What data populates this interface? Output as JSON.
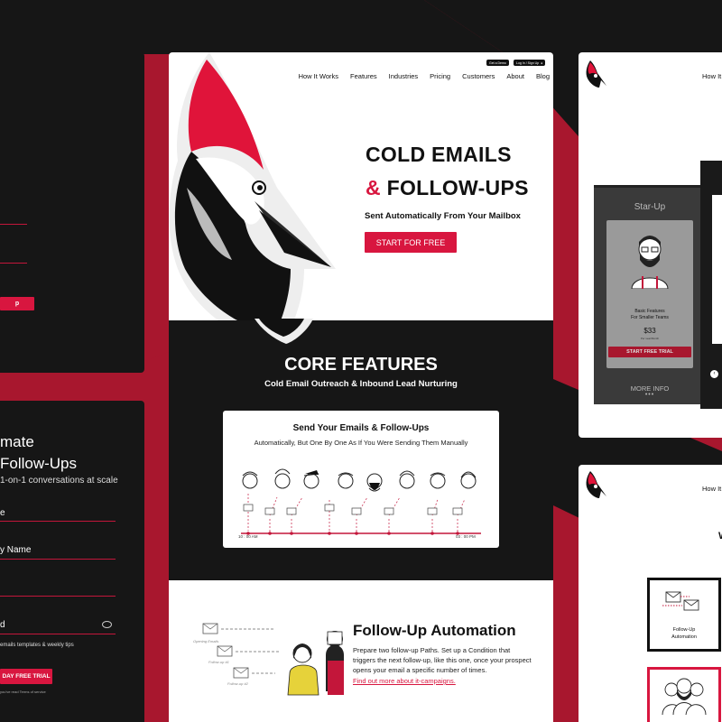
{
  "colors": {
    "accent": "#d8163f",
    "dark": "#161616",
    "background_red": "#a8172e"
  },
  "left_top": {
    "button_label": "p"
  },
  "left_bottom": {
    "headline_1": "mate",
    "headline_2": "Follow-Ups",
    "subline": "1-on-1 conversations at scale",
    "field_1": "e",
    "field_2": "y Name",
    "field_3": "d",
    "checkbox_label": "emails templates & weekly tips",
    "cta": "DAY FREE TRIAL",
    "fineprint": "you've read Terms of service"
  },
  "center": {
    "top_buttons": [
      "Get a Demo",
      "Log In / Sign Up"
    ],
    "nav": [
      "How It Works",
      "Features",
      "Industries",
      "Pricing",
      "Customers",
      "About",
      "Blog"
    ],
    "hero": {
      "title_line1": "COLD EMAILS",
      "title_amp": "&",
      "title_line2": "FOLLOW-UPS",
      "subtitle": "Sent Automatically From Your Mailbox",
      "cta": "START FOR FREE"
    },
    "core": {
      "title": "CORE FEATURES",
      "subtitle": "Cold Email Outreach & Inbound Lead Nurturing"
    },
    "card": {
      "title": "Send Your Emails & Follow-Ups",
      "subtitle": "Automatically, But One By One As If You Were Sending Them Manually",
      "time_start": "10 : 00 AM",
      "time_end": "03 : 00 PM"
    },
    "followup": {
      "title": "Follow-Up Automation",
      "body": "Prepare two follow-up Paths. Set up a Condition that triggers the next follow-up, like this one, once your prospect opens your email a specific number of times.",
      "link": "Find out more about it-campaigns.",
      "diagram_labels": [
        "Opening Emails",
        "Follow-up #1",
        "Follow-up #2"
      ]
    }
  },
  "right_top": {
    "nav_item": "How It",
    "plan_name": "Star-Up",
    "features_1": "Basic Features",
    "features_2": "For Smaller Teams",
    "price": "$33",
    "price_note": "Per seat/Month",
    "cta": "START FREE TRIAL",
    "more": "MORE INFO"
  },
  "right_bottom": {
    "nav_item": "How It",
    "letter": "W",
    "box_label_1": "Follow-Up",
    "box_label_2": "Automation"
  }
}
